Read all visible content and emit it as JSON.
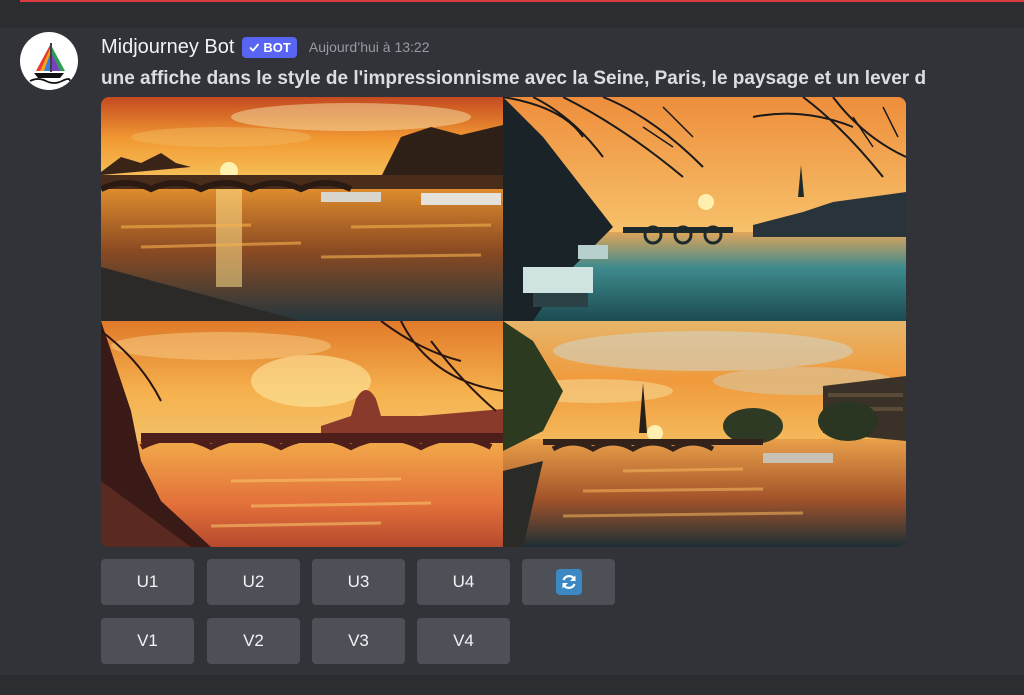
{
  "message": {
    "author": "Midjourney Bot",
    "badge": "BOT",
    "timestamp": "Aujourd’hui à 13:22",
    "prompt": "une affiche dans le style de l'impressionnisme avec la Seine, Paris, le paysage et un lever d"
  },
  "buttons": {
    "upscale": [
      "U1",
      "U2",
      "U3",
      "U4"
    ],
    "variation": [
      "V1",
      "V2",
      "V3",
      "V4"
    ],
    "reroll_icon": "refresh-icon"
  },
  "colors": {
    "background": "#313338",
    "button": "#4e5058",
    "badge": "#5865f2",
    "reroll": "#3b88c3"
  }
}
